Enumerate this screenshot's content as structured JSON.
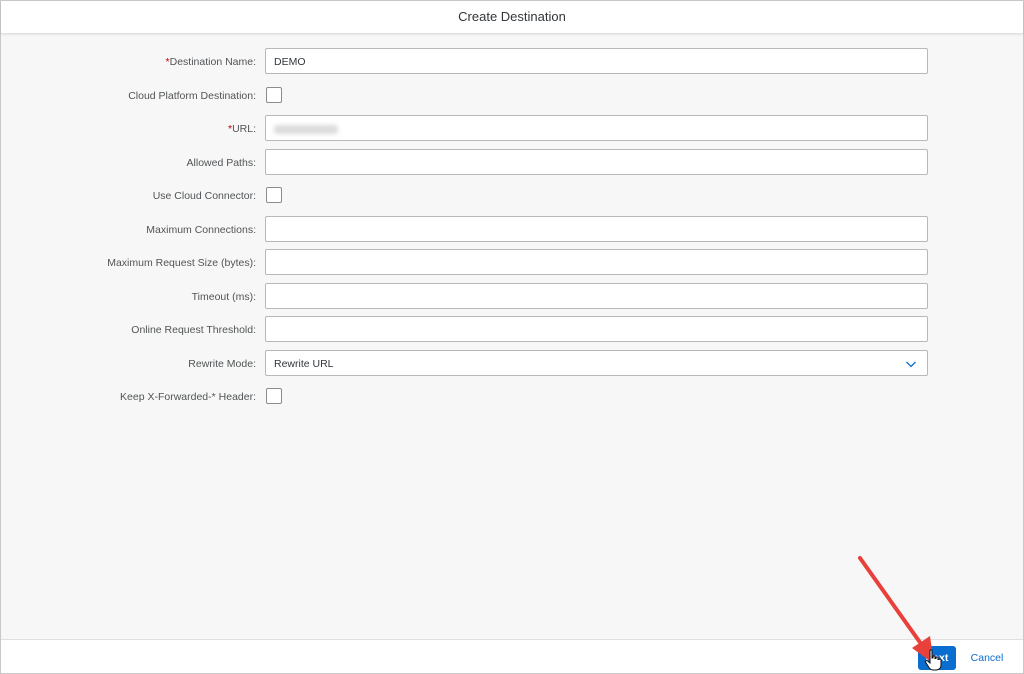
{
  "dialog": {
    "title": "Create Destination"
  },
  "form": {
    "destination_name": {
      "required_mark": "*",
      "label": "Destination Name:",
      "value": "DEMO"
    },
    "cloud_platform_destination": {
      "label": "Cloud Platform Destination:",
      "checked": false
    },
    "url": {
      "required_mark": "*",
      "label": "URL:"
    },
    "allowed_paths": {
      "label": "Allowed Paths:",
      "value": ""
    },
    "use_cloud_connector": {
      "label": "Use Cloud Connector:",
      "checked": false
    },
    "max_connections": {
      "label": "Maximum Connections:",
      "value": ""
    },
    "max_request_size": {
      "label": "Maximum Request Size (bytes):",
      "value": ""
    },
    "timeout": {
      "label": "Timeout (ms):",
      "value": ""
    },
    "online_request_threshold": {
      "label": "Online Request Threshold:",
      "value": ""
    },
    "rewrite_mode": {
      "label": "Rewrite Mode:",
      "value": "Rewrite URL"
    },
    "keep_x_forwarded_header": {
      "label": "Keep X-Forwarded-* Header:",
      "checked": false
    }
  },
  "footer": {
    "next_label": "Next",
    "cancel_label": "Cancel"
  },
  "icons": {
    "select": "chevron-down-icon",
    "annotation": "red-arrow-icon",
    "pointer": "hand-cursor-icon"
  },
  "colors": {
    "accent": "#0a6ed1",
    "required": "#bb0000",
    "annotation_arrow": "#e8403a"
  }
}
